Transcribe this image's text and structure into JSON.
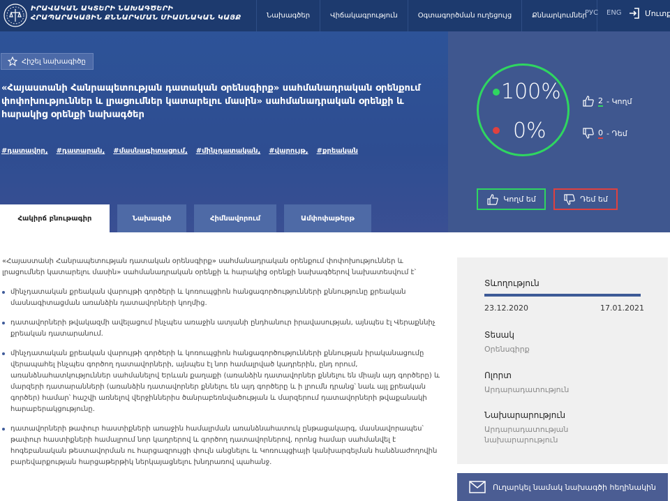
{
  "header": {
    "brand_line1": "ԻՐԱՎԱԿԱՆ ԱԿՏԵՐԻ ՆԱԽԱԳԾԵՐԻ",
    "brand_line2": "ՀՐԱՊԱՐԱԿԱՅԻՆ ՔՆՆԱՐԿՄԱՆ ՄԻԱՍՆԱԿԱՆ ԿԱՅՔ",
    "nav": [
      "Նախագծեր",
      "Վիճակագրություն",
      "Օգտագործման ուղեցույց",
      "Քննարկումներ"
    ],
    "lang_ru": "РУС",
    "lang_en": "ENG",
    "login": "Մուտք"
  },
  "hero": {
    "save_label": "Հիշել նախագիծը",
    "title": "«Հայաստանի Հանրապետության դատական օրենսգիրք» սահմանադրական օրենքում փոփոխություններ և լրացումներ կատարելու մասին» սահմանադրական օրենքի և հարակից օրենքի նախագծեր",
    "tags": [
      "#դատավոր,",
      "#դատարան,",
      "#մասնագիտացում,",
      "#մինչդատական,",
      "#վարույթ,",
      "#քրեական"
    ],
    "tabs": [
      "Հակիրճ բնութագիր",
      "Նախագիծ",
      "Հիմնավորում",
      "Ամփոփաթերթ"
    ]
  },
  "vote": {
    "for_pct": "100%",
    "against_pct": "0%",
    "for_count": "2",
    "for_label": "- Կողմ",
    "against_count": "0",
    "against_label": "- Դեմ",
    "for_button": "Կողմ եմ",
    "against_button": "Դեմ եմ",
    "colors": {
      "for": "#2fd660",
      "against": "#e0413f"
    }
  },
  "content": {
    "intro": "«Հայաստանի Հանրապետության դատական օրենսգիրք» սահմանադրական օրենքում փոփոխություններ և լրացումներ կատարելու մասին» սահմանադրական օրենքի և հարակից օրենքի նախագծերով նախատեսվում է՝",
    "bullets": [
      "մինչդատական քրեական վարույթի գործերի և կոռուպցիոն հանցագործությունների քննությունը քրեական մասնագիտացման առանձին դատավորների կողմից.",
      "դատավորների թվակազմի ավելացում ինչպես առաջին ատյանի ընդհանուր իրավասության, այնպես էլ Վերաքննիչ քրեական դատարանում.",
      "մինչդատական քրեական վարույթի գործերի և կոռուպցիոն հանցագործությունների քննության իրականացումը վերապահել ինչպես գործող դատավորների, այնպես էլ նոր համալրված կադրերին, ընդ որում, առանձնահատկություններ սահմանելով Երևան քաղաքի (առանձին դատավորներ քննելու են միայն այդ գործերը) և մարզերի դատարանների (առանձին դատավորներ քննելու են այդ գործերը և ի լրումն դրանց՝ նաև այլ քրեական գործեր) համար՝ հաշվի առնելով վերջիններիս ծանրաբեռնվածության և մարզերում դատավորների թվաքանակի հարաբերակցությունը.",
      "դատավորների թափուր հաստիքների առաջին համալրման առանձնահատուկ ընթացակարգ, մասնավորապես՝ թափուր հաստիքների համալրում նոր կադրերով և գործող դատավորներով, որոնց համար սահմանվել է հոգեբանական թեստավորման ու հարցազրույցի փուլն անցնելու և Կոռուպցիայի կանխարգելման հանձնաժողովին բարեվարքության հարցաթերթիկ ներկայացնելու խնդրառով պահանջ."
    ]
  },
  "side": {
    "duration_label": "Տևողություն",
    "date_start": "23.12.2020",
    "date_end": "17.01.2021",
    "progress": 1.0,
    "type_label": "Տեսակ",
    "type_value": "Օրենսգիրք",
    "field_label": "Ոլորտ",
    "field_value": "Արդարադատություն",
    "ministry_label": "Նախարարություն",
    "ministry_value": "Արդարադատության նախարարություն"
  },
  "send_button": "Ուղարկել նամակ նախագծի հեղինակին"
}
